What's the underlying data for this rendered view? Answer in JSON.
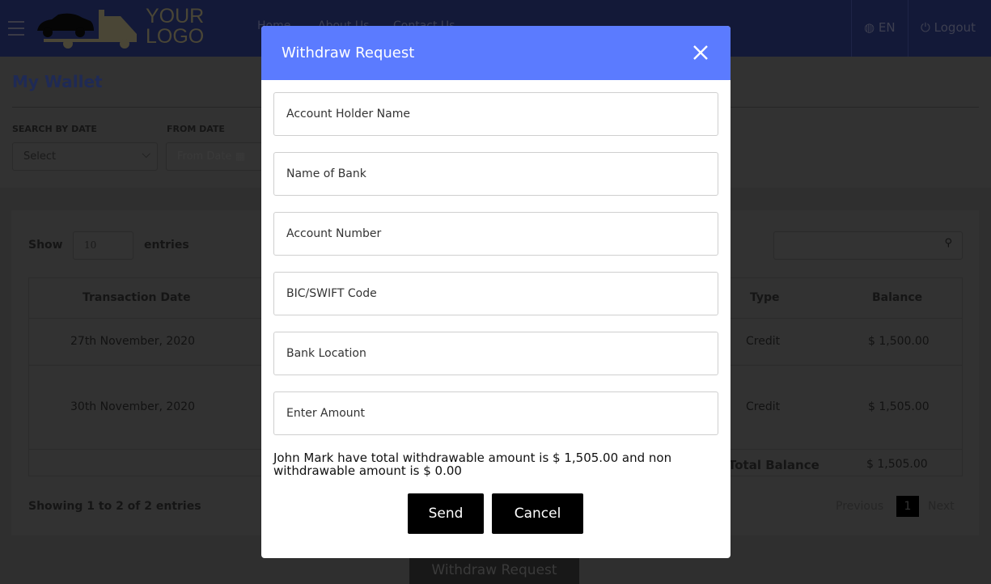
{
  "header": {
    "logo_line1": "YOUR",
    "logo_line2": "LOGO",
    "nav": [
      "Home",
      "About Us",
      "Contact Us"
    ],
    "language": "EN",
    "logout": "Logout"
  },
  "page": {
    "title": "My Wallet",
    "search_by_date_label": "SEARCH BY DATE",
    "search_by_date_value": "Select",
    "from_date_label": "FROM DATE",
    "from_date_placeholder": "From Date"
  },
  "table": {
    "show_label": "Show",
    "entries_value": "10",
    "entries_label": "entries",
    "columns": {
      "date": "Transaction Date",
      "type": "Type",
      "balance": "Balance"
    },
    "rows": [
      {
        "date": "27th November, 2020",
        "type": "Credit",
        "balance": "$ 1,500.00"
      },
      {
        "date": "30th November, 2020",
        "type": "Credit",
        "balance": "$ 1,505.00"
      }
    ],
    "total_label": "Total Balance",
    "total_value": "$ 1,505.00",
    "info": "Showing 1 to 2 of 2 entries",
    "previous": "Previous",
    "page": "1",
    "next": "Next"
  },
  "withdraw_button": "Withdraw Request",
  "modal": {
    "title": "Withdraw Request",
    "fields": [
      "Account Holder Name",
      "Name of Bank",
      "Account Number",
      "BIC/SWIFT Code",
      "Bank Location",
      "Enter Amount"
    ],
    "info": "John Mark have total withdrawable amount is $ 1,505.00 and non withdrawable amount is $ 0.00",
    "send": "Send",
    "cancel": "Cancel"
  },
  "colors": {
    "modal_header": "#5b7bff",
    "header": "#131938"
  }
}
